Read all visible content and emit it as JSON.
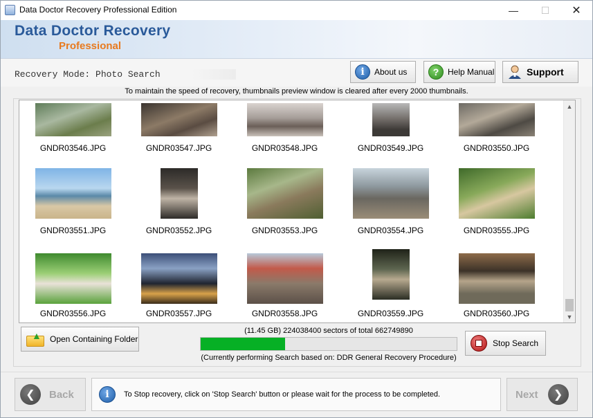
{
  "window": {
    "title": "Data Doctor Recovery Professional Edition"
  },
  "header": {
    "brand": "Data Doctor Recovery",
    "edition": "Professional"
  },
  "mode": {
    "label": "Recovery Mode: Photo Search"
  },
  "buttons": {
    "about": "About us",
    "manual": "Help Manual",
    "support": "Support"
  },
  "notice": "To maintain the speed of recovery, thumbnails preview window is cleared after every 2000 thumbnails.",
  "gallery": {
    "items": [
      {
        "name": "GNDR03546.JPG"
      },
      {
        "name": "GNDR03547.JPG"
      },
      {
        "name": "GNDR03548.JPG"
      },
      {
        "name": "GNDR03549.JPG"
      },
      {
        "name": "GNDR03550.JPG"
      },
      {
        "name": "GNDR03551.JPG"
      },
      {
        "name": "GNDR03552.JPG"
      },
      {
        "name": "GNDR03553.JPG"
      },
      {
        "name": "GNDR03554.JPG"
      },
      {
        "name": "GNDR03555.JPG"
      },
      {
        "name": "GNDR03556.JPG"
      },
      {
        "name": "GNDR03557.JPG"
      },
      {
        "name": "GNDR03558.JPG"
      },
      {
        "name": "GNDR03559.JPG"
      },
      {
        "name": "GNDR03560.JPG"
      }
    ]
  },
  "actions": {
    "open_folder": "Open Containing Folder",
    "stop": "Stop Search"
  },
  "progress": {
    "size_info": "(11.45 GB) 224038400  sectors  of  total 662749890",
    "fraction": 0.33,
    "procedure": "(Currently performing Search based on:  DDR General Recovery Procedure)"
  },
  "footer": {
    "back": "Back",
    "next": "Next",
    "info": "To Stop recovery, click on 'Stop Search' button or please wait for the process to be completed."
  },
  "colors": {
    "brand": "#2a5a9a",
    "edition": "#e87a1e",
    "progress": "#06b025"
  }
}
